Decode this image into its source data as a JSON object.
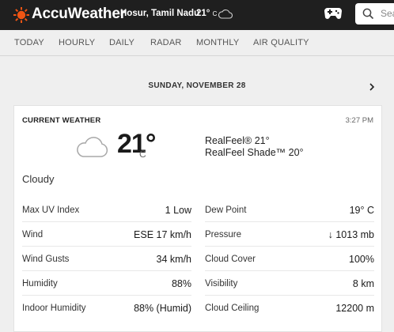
{
  "header": {
    "brand": "AccuWeather",
    "location": "Hosur, Tamil Nadu",
    "temp": "21°",
    "temp_unit": "C",
    "search_placeholder": "Search",
    "brand_color": "#f05514"
  },
  "nav": {
    "tabs": [
      {
        "label": "TODAY"
      },
      {
        "label": "HOURLY"
      },
      {
        "label": "DAILY"
      },
      {
        "label": "RADAR"
      },
      {
        "label": "MONTHLY"
      },
      {
        "label": "AIR QUALITY"
      }
    ]
  },
  "date": "SUNDAY, NOVEMBER 28",
  "current": {
    "title": "CURRENT WEATHER",
    "time": "3:27 PM",
    "icon": "cloud-icon",
    "temp": "21°",
    "unit": "C",
    "realfeel": "RealFeel® 21°",
    "realfeel_shade": "RealFeel Shade™ 20°",
    "phrase": "Cloudy",
    "left": [
      {
        "label": "Max UV Index",
        "value": "1 Low"
      },
      {
        "label": "Wind",
        "value": "ESE 17 km/h"
      },
      {
        "label": "Wind Gusts",
        "value": "34 km/h"
      },
      {
        "label": "Humidity",
        "value": "88%"
      },
      {
        "label": "Indoor Humidity",
        "value": "88% (Humid)"
      }
    ],
    "right": [
      {
        "label": "Dew Point",
        "value": "19° C"
      },
      {
        "label": "Pressure",
        "value": "↓ 1013 mb"
      },
      {
        "label": "Cloud Cover",
        "value": "100%"
      },
      {
        "label": "Visibility",
        "value": "8 km"
      },
      {
        "label": "Cloud Ceiling",
        "value": "12200 m"
      }
    ]
  }
}
